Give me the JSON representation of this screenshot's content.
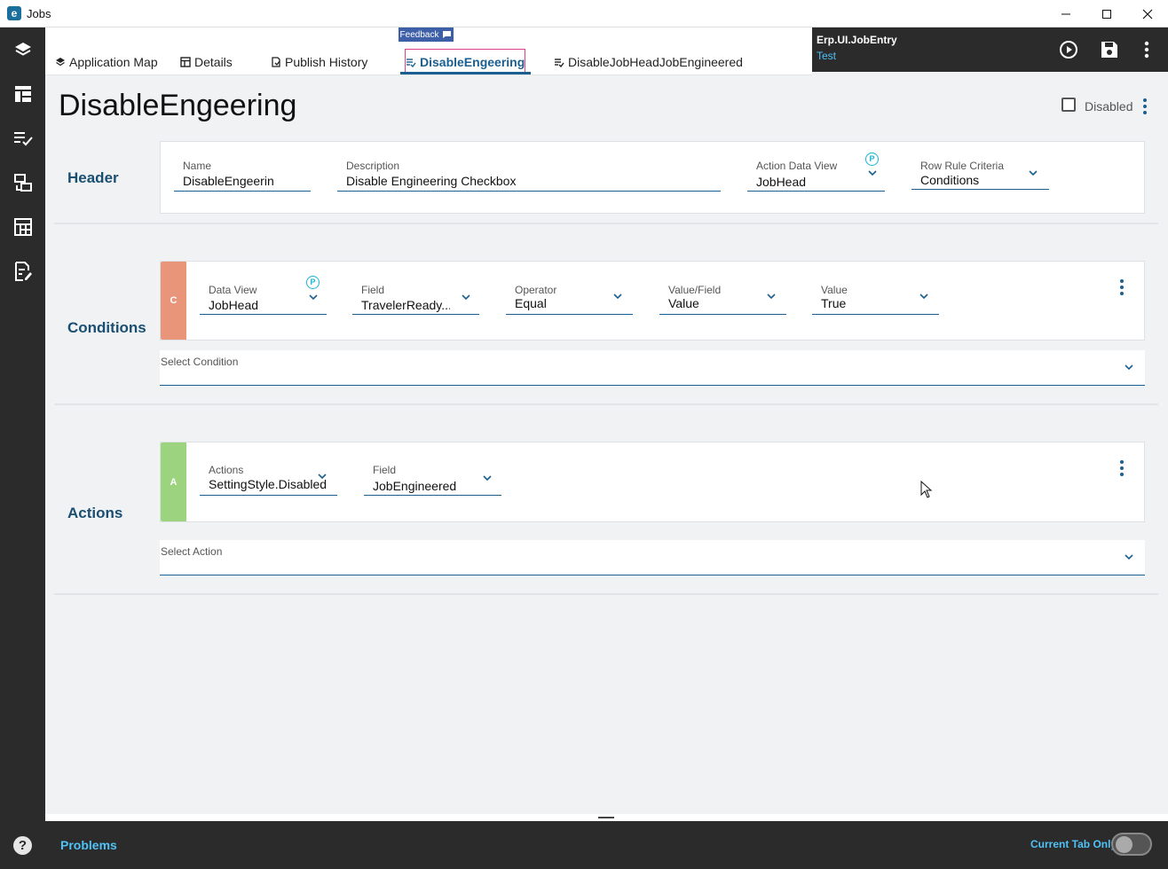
{
  "window": {
    "title": "Jobs",
    "logo": "e"
  },
  "sidebar": {
    "icons": [
      "layers-icon",
      "layout-icon",
      "checklist-icon",
      "transfer-icon",
      "calendar-grid-icon",
      "document-edit-icon"
    ],
    "help": "?"
  },
  "tabs": {
    "feedback_label": "Feedback",
    "items": [
      {
        "label": "Application Map",
        "icon": "layers-icon"
      },
      {
        "label": "Details",
        "icon": "table-icon"
      },
      {
        "label": "Publish History",
        "icon": "history-icon"
      },
      {
        "label": "DisableEngeering",
        "icon": "rule-icon",
        "active": true
      },
      {
        "label": "DisableJobHeadJobEngineered",
        "icon": "rule-icon"
      }
    ]
  },
  "context": {
    "title": "Erp.UI.JobEntry",
    "subtitle": "Test"
  },
  "page": {
    "title": "DisableEngeering",
    "disabled_label": "Disabled",
    "disabled_checked": false
  },
  "header": {
    "label": "Header",
    "name": {
      "label": "Name",
      "value": "DisableEngeerin"
    },
    "description": {
      "label": "Description",
      "value": "Disable Engineering Checkbox"
    },
    "action_data_view": {
      "label": "Action Data View",
      "value": "JobHead"
    },
    "row_rule_criteria": {
      "label": "Row Rule Criteria",
      "value": "Conditions"
    }
  },
  "conditions": {
    "label": "Conditions",
    "tag": "C",
    "tag_color": "#e9957a",
    "data_view": {
      "label": "Data View",
      "value": "JobHead"
    },
    "field": {
      "label": "Field",
      "value": "TravelerReady..."
    },
    "operator": {
      "label": "Operator",
      "value": "Equal"
    },
    "value_field": {
      "label": "Value/Field",
      "value": "Value"
    },
    "value": {
      "label": "Value",
      "value": "True"
    },
    "select_label": "Select Condition"
  },
  "actions": {
    "label": "Actions",
    "tag": "A",
    "tag_color": "#9bd37e",
    "action": {
      "label": "Actions",
      "value": "SettingStyle.Disabled"
    },
    "field": {
      "label": "Field",
      "value": "JobEngineered"
    },
    "select_label": "Select Action"
  },
  "p_badge": "P",
  "bottom": {
    "problems": "Problems",
    "current_tab_only": "Current Tab Only",
    "toggle_on": false
  },
  "colors": {
    "accent": "#1a5f8f",
    "sidebar": "#2b2b2b",
    "link": "#4fc3f7"
  }
}
